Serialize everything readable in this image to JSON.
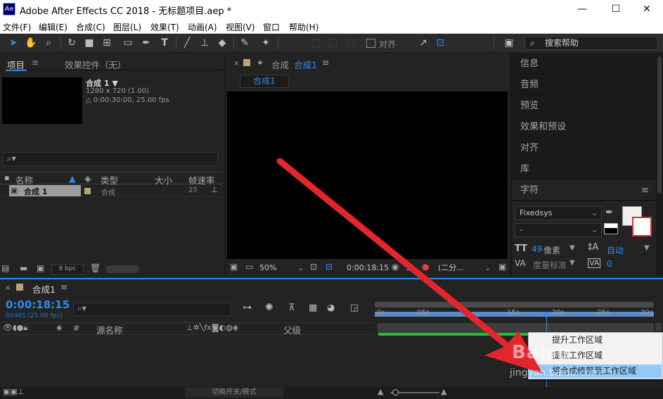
{
  "window": {
    "app_logo": "Ae",
    "title": "Adobe After Effects CC 2018 - 无标题项目.aep *",
    "controls": {
      "minimize": "—",
      "maximize": "☐",
      "close": "✕"
    }
  },
  "menu": [
    "文件(F)",
    "编辑(E)",
    "合成(C)",
    "图层(L)",
    "效果(T)",
    "动画(A)",
    "视图(V)",
    "窗口",
    "帮助(H)"
  ],
  "toolbar": {
    "align_label": "对齐",
    "search_help_placeholder": "搜索帮助"
  },
  "project_panel": {
    "tab_project": "项目",
    "tab_effects": "效果控件（无）",
    "comp_name": "合成 1 ▼",
    "comp_res": "1280 x 720 (1.00)",
    "comp_dur": "△ 0:00:30:00, 25.00 fps",
    "columns": {
      "name": "名称",
      "type": "类型",
      "size": "大小",
      "fps": "帧速率"
    },
    "row": {
      "name": "合成 1",
      "type": "合成",
      "fps": "25"
    },
    "bpc": "8 bpc"
  },
  "comp_viewer": {
    "tab_label": "合成",
    "tab_name": "合成1",
    "sub_tab": "合成1",
    "zoom": "50%",
    "timecode": "0:00:18:15",
    "resolution": "(二分..."
  },
  "right_panels": [
    "信息",
    "音频",
    "预览",
    "效果和预设",
    "对齐",
    "库"
  ],
  "character": {
    "title": "字符",
    "font": "Fixedsys",
    "style": "-",
    "size_value": "49",
    "size_unit": "像素",
    "leading": "自动",
    "kerning": "度量标准",
    "tracking": "0"
  },
  "timeline": {
    "comp_tab": "合成1",
    "timecode": "0:00:18:15",
    "frames": "00465 (25.00 fps)",
    "col_source": "源名称",
    "col_parent": "父级",
    "col_hash": "#",
    "ruler": [
      "0s",
      "05s",
      "15s",
      "20s",
      "25s",
      "30s"
    ],
    "playhead_fraction": 0.615,
    "bottom_label": "切换开关/模式"
  },
  "context_menu": {
    "items": [
      "提升工作区域",
      "提取工作区域",
      "将合成修剪至工作区域"
    ],
    "highlighted_index": 2
  },
  "watermark": "jingyan.baidu.com",
  "colors": {
    "accent": "#2d8ceb",
    "arrow": "#e3262c",
    "bg": "#232323",
    "work_area": "#5b8bc4"
  }
}
